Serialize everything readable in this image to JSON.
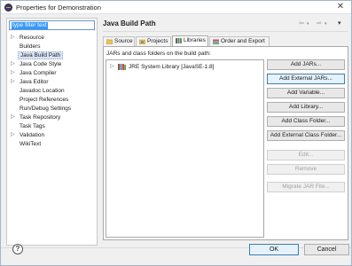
{
  "window": {
    "title": "Properties for Demonstration",
    "close_glyph": "✕"
  },
  "filter": {
    "value": "type filter text"
  },
  "tree": [
    {
      "label": "Resource",
      "expandable": true
    },
    {
      "label": "Builders",
      "expandable": false
    },
    {
      "label": "Java Build Path",
      "expandable": false,
      "selected": true
    },
    {
      "label": "Java Code Style",
      "expandable": true
    },
    {
      "label": "Java Compiler",
      "expandable": true
    },
    {
      "label": "Java Editor",
      "expandable": true
    },
    {
      "label": "Javadoc Location",
      "expandable": false
    },
    {
      "label": "Project References",
      "expandable": false
    },
    {
      "label": "Run/Debug Settings",
      "expandable": false
    },
    {
      "label": "Task Repository",
      "expandable": true
    },
    {
      "label": "Task Tags",
      "expandable": false
    },
    {
      "label": "Validation",
      "expandable": true
    },
    {
      "label": "WikiText",
      "expandable": false
    }
  ],
  "page": {
    "title": "Java Build Path"
  },
  "nav": {
    "back_glyph": "⇦",
    "forward_glyph": "⇨",
    "dropdown_glyph": "▾",
    "menu_glyph": "▾"
  },
  "tabs": [
    {
      "label": "Source",
      "icon": "source-folder-icon"
    },
    {
      "label": "Projects",
      "icon": "projects-icon"
    },
    {
      "label": "Libraries",
      "icon": "libraries-icon",
      "active": true
    },
    {
      "label": "Order and Export",
      "icon": "order-export-icon"
    }
  ],
  "libraries": {
    "caption": "JARs and class folders on the build path:",
    "entries": [
      {
        "label": "JRE System Library [JavaSE-1.8]"
      }
    ]
  },
  "buttons": [
    {
      "label": "Add JARs...",
      "enabled": true
    },
    {
      "label": "Add External JARs...",
      "enabled": true,
      "focused": true
    },
    {
      "label": "Add Variable...",
      "enabled": true
    },
    {
      "label": "Add Library...",
      "enabled": true
    },
    {
      "label": "Add Class Folder...",
      "enabled": true
    },
    {
      "label": "Add External Class Folder...",
      "enabled": true
    },
    {
      "label": "Edit...",
      "enabled": false
    },
    {
      "label": "Remove",
      "enabled": false
    },
    {
      "label": "Migrate JAR File...",
      "enabled": false
    }
  ],
  "footer": {
    "help_glyph": "?",
    "ok_label": "OK",
    "cancel_label": "Cancel"
  },
  "colors": {
    "selection": "#3399ff",
    "accent": "#3c7fb1"
  }
}
